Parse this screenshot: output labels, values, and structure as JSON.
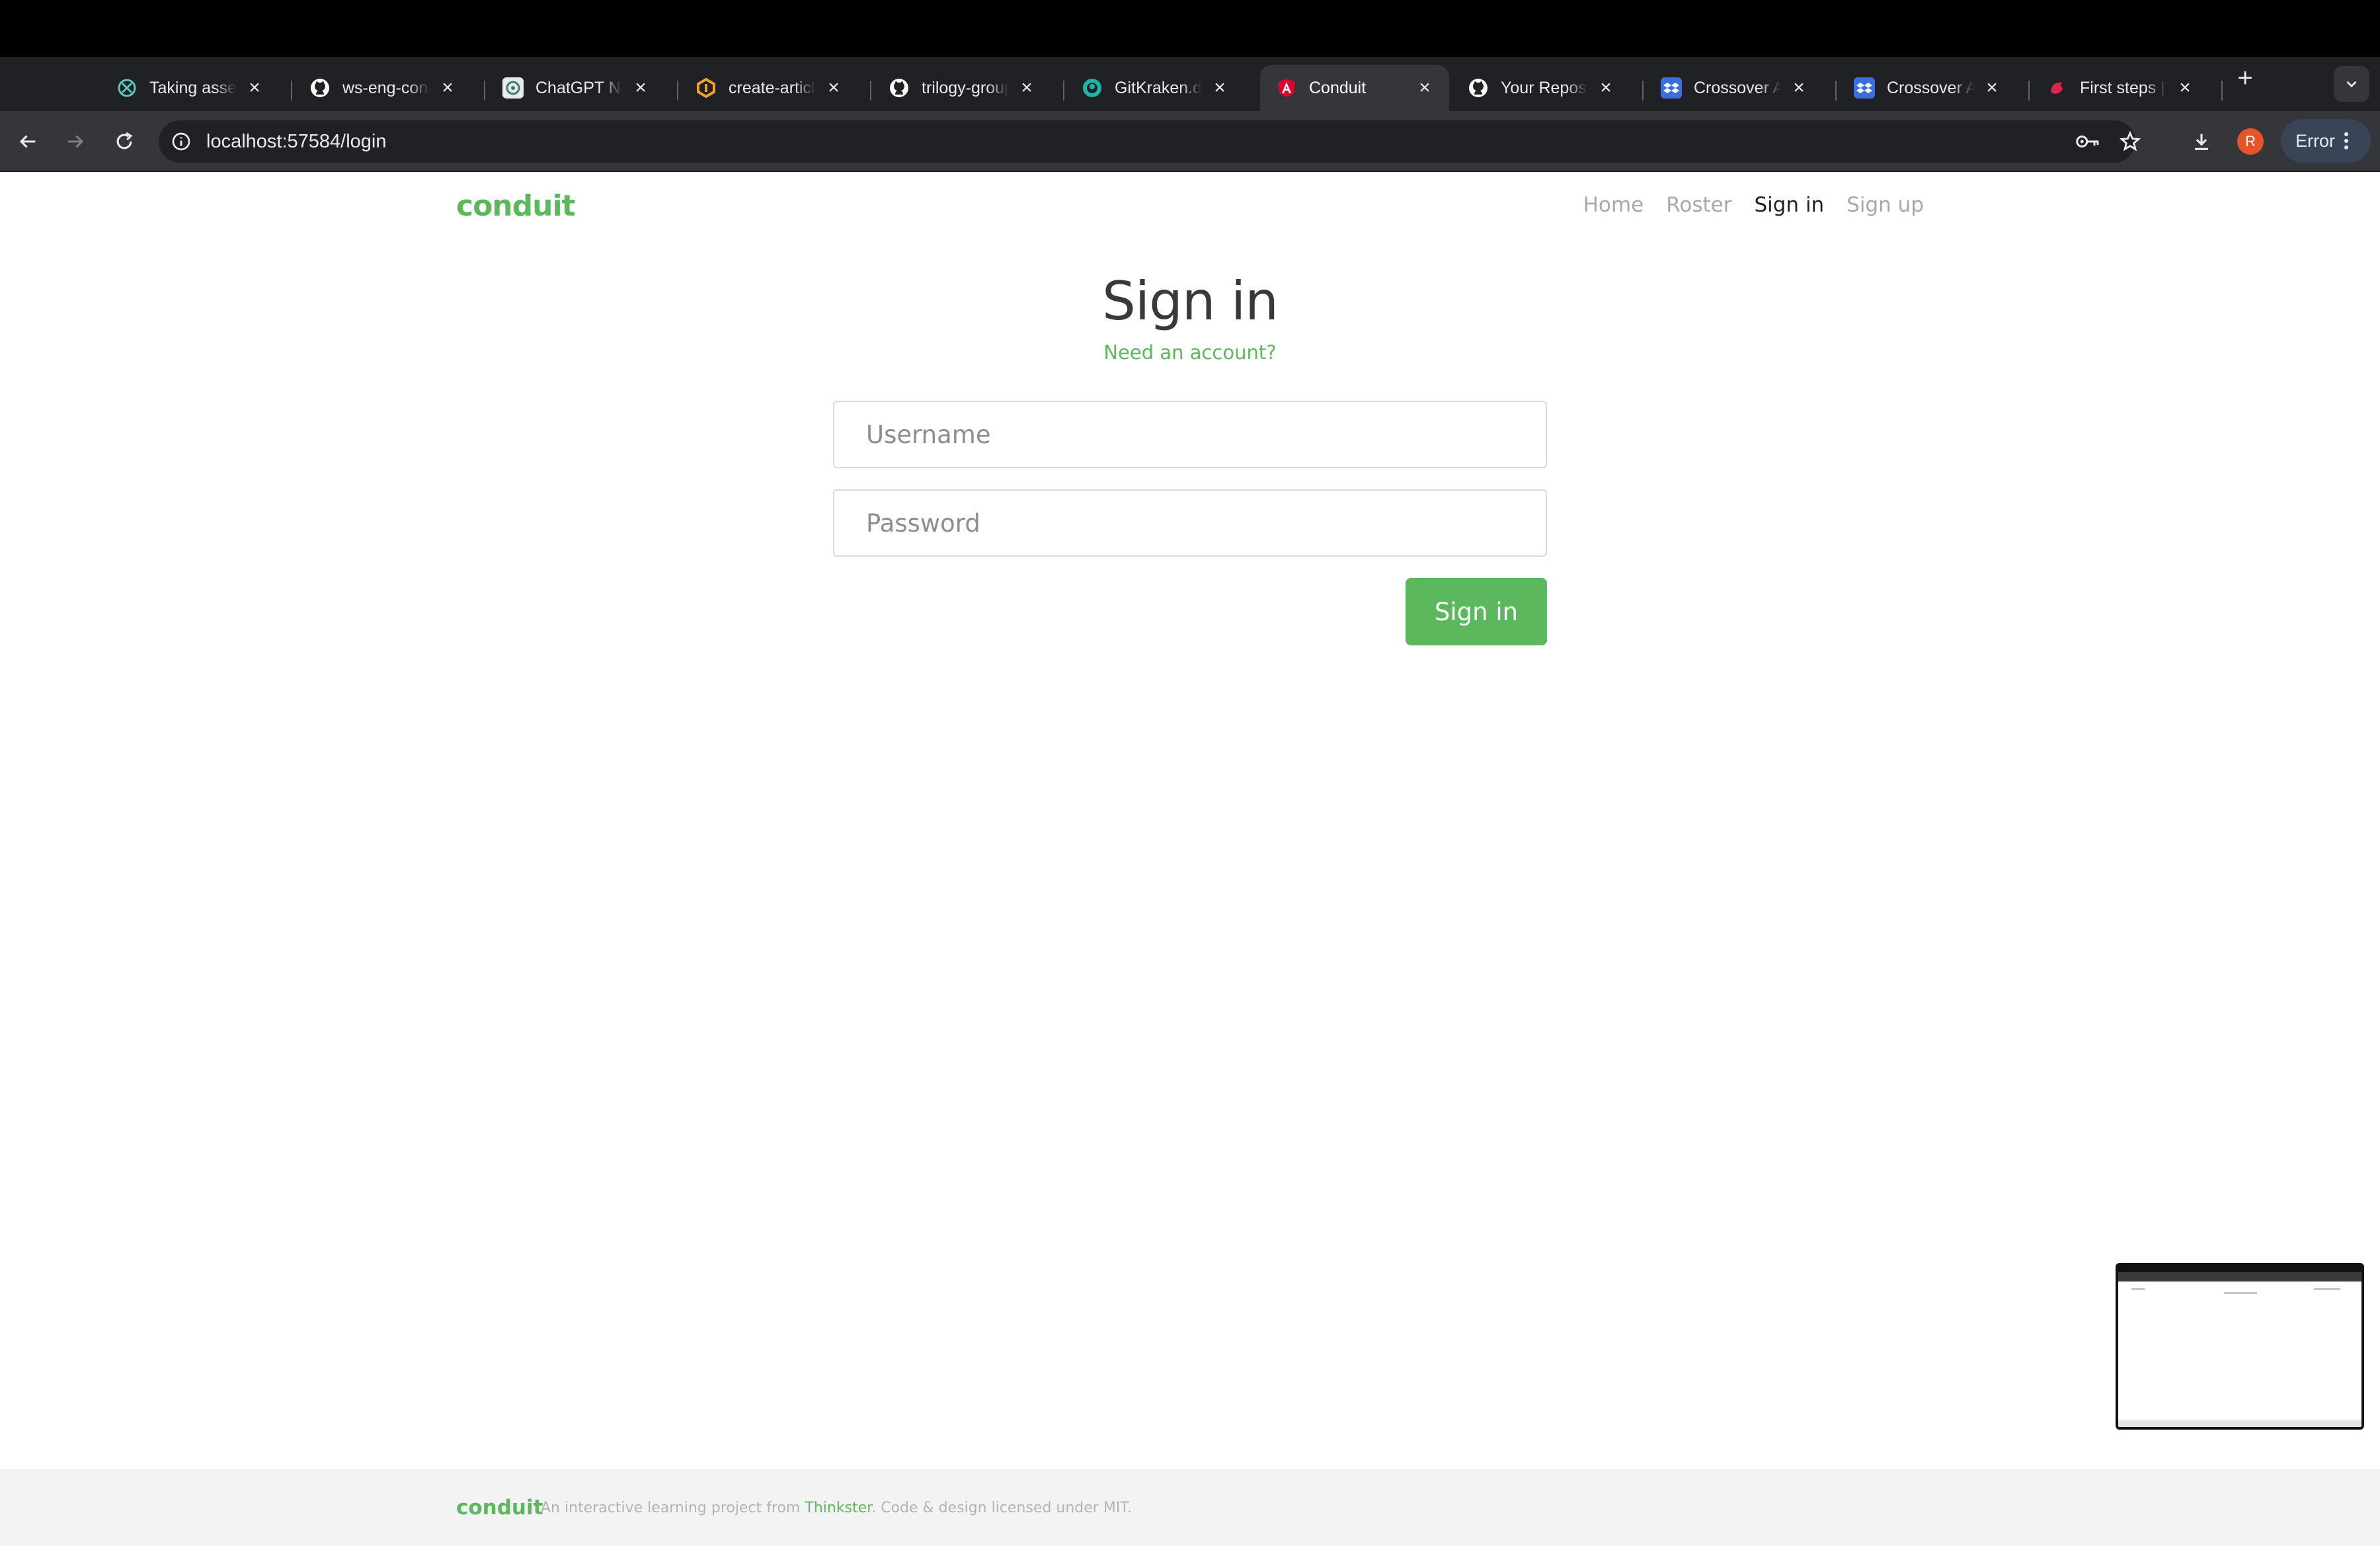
{
  "browser": {
    "tabs": [
      {
        "title": "Taking assessment",
        "icon": "crossover-icon",
        "active": false
      },
      {
        "title": "ws-eng-conduit",
        "icon": "github-icon",
        "active": false
      },
      {
        "title": "ChatGPT Next",
        "icon": "chatgpt-icon",
        "active": false
      },
      {
        "title": "create-article",
        "icon": "gitkraken-orange-icon",
        "active": false
      },
      {
        "title": "trilogy-group",
        "icon": "github-icon",
        "active": false
      },
      {
        "title": "GitKraken.dev",
        "icon": "gitkraken-icon",
        "active": false
      },
      {
        "title": "Conduit",
        "icon": "angular-icon",
        "active": true
      },
      {
        "title": "Your Repositories",
        "icon": "github-icon",
        "active": false
      },
      {
        "title": "Crossover Assessment",
        "icon": "dropbox-icon",
        "active": false
      },
      {
        "title": "Crossover Assessment",
        "icon": "dropbox-icon",
        "active": false
      },
      {
        "title": "First steps | NestJS",
        "icon": "nestjs-icon",
        "active": false
      }
    ],
    "address": "localhost:57584/login",
    "profile_initial": "R",
    "status_button": "Error",
    "colors": {
      "frame": "#202124",
      "toolbar": "#35363a",
      "accent_profile": "#e8542a"
    }
  },
  "app": {
    "brand": "conduit",
    "nav": {
      "home": "Home",
      "roster": "Roster",
      "signin": "Sign in",
      "signup": "Sign up"
    },
    "auth": {
      "title": "Sign in",
      "need_account": "Need an account?",
      "username_placeholder": "Username",
      "password_placeholder": "Password",
      "submit_label": "Sign in"
    },
    "footer": {
      "brand": "conduit",
      "text_before": "An interactive learning project from ",
      "link": "Thinkster",
      "text_after": ". Code & design licensed under MIT."
    },
    "colors": {
      "primary": "#5cb85c",
      "title": "#373a3c",
      "muted": "#aaaaaa"
    }
  }
}
